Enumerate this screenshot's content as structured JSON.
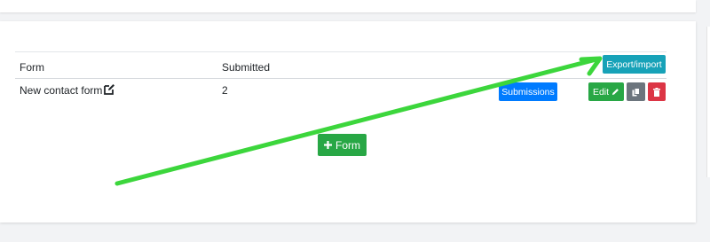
{
  "table": {
    "columns": [
      "Form",
      "Submitted"
    ],
    "rows": [
      {
        "form": "New contact form",
        "submitted": "2"
      }
    ]
  },
  "buttons": {
    "export_import": "Export/import",
    "submissions": "Submissions",
    "edit": "Edit",
    "add_form": "Form"
  },
  "icons": {
    "row_edit": "edit-square-icon",
    "edit": "pencil-icon",
    "copy": "copy-icon",
    "delete": "trash-icon",
    "add": "plus-icon"
  },
  "colors": {
    "info": "#17a2b8",
    "primary": "#007bff",
    "success": "#28a745",
    "secondary": "#6c757d",
    "danger": "#dc3545",
    "annotation_arrow": "#3cd63c"
  }
}
